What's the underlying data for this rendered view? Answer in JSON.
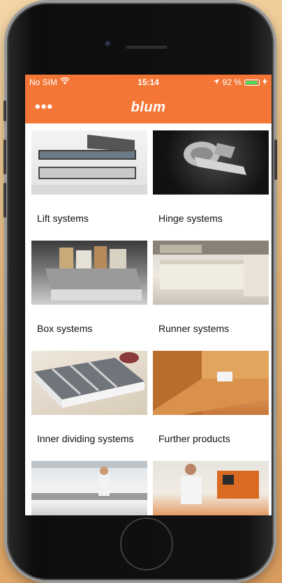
{
  "statusbar": {
    "carrier": "No SIM",
    "time": "15:14",
    "battery": "92 %",
    "battery_level": 0.92
  },
  "appbar": {
    "menu_label": "•••",
    "logo": "blum"
  },
  "tiles": [
    {
      "label": "Lift systems"
    },
    {
      "label": "Hinge systems"
    },
    {
      "label": "Box systems"
    },
    {
      "label": "Runner systems"
    },
    {
      "label": "Inner dividing systems"
    },
    {
      "label": "Further products"
    },
    {
      "label": ""
    },
    {
      "label": ""
    }
  ],
  "colors": {
    "accent": "#f37636",
    "battery": "#4cd964"
  }
}
